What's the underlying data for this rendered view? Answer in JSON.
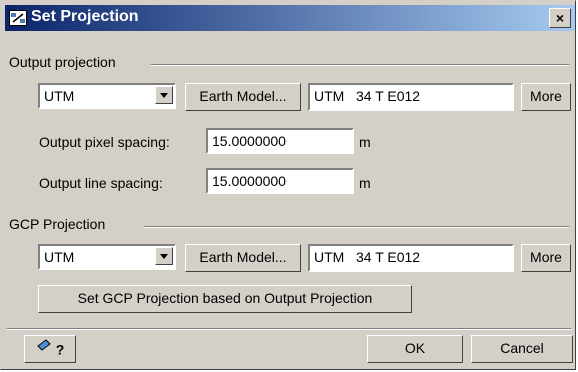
{
  "window": {
    "title": "Set Projection",
    "close_label": "×"
  },
  "output": {
    "group_label": "Output projection",
    "projection_value": "UTM",
    "earth_model_label": "Earth Model...",
    "projection_text": "UTM   34 T E012",
    "more_label": "More",
    "pixel_spacing_label": "Output pixel spacing:",
    "pixel_spacing_value": "15.0000000",
    "pixel_spacing_unit": "m",
    "line_spacing_label": "Output line spacing:",
    "line_spacing_value": "15.0000000",
    "line_spacing_unit": "m"
  },
  "gcp": {
    "group_label": "GCP Projection",
    "projection_value": "UTM",
    "earth_model_label": "Earth Model...",
    "projection_text": "UTM   34 T E012",
    "more_label": "More",
    "set_gcp_label": "Set GCP Projection based on Output Projection"
  },
  "footer": {
    "help_label": "?",
    "ok_label": "OK",
    "cancel_label": "Cancel"
  },
  "icons": {
    "title": "satellite-icon",
    "help": "help-icon"
  },
  "colors": {
    "titlebar_start": "#0a246a",
    "titlebar_end": "#a6caf0",
    "face": "#d4d0c8"
  }
}
